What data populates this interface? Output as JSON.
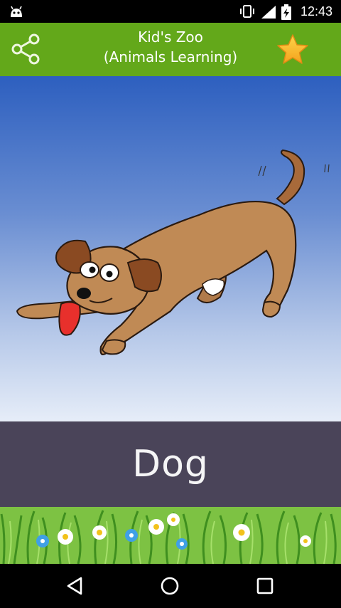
{
  "status": {
    "time": "12:43"
  },
  "app": {
    "title_line1": "Kid's Zoo",
    "title_line2": "(Animals Learning)",
    "appbar_color": "#63a81a"
  },
  "icons": {
    "share": "share-icon",
    "favorite": "star-icon",
    "back": "back-icon",
    "home": "home-icon",
    "recents": "recents-icon"
  },
  "card": {
    "animal_name": "Dog",
    "name_bar_color": "#4a4459"
  }
}
